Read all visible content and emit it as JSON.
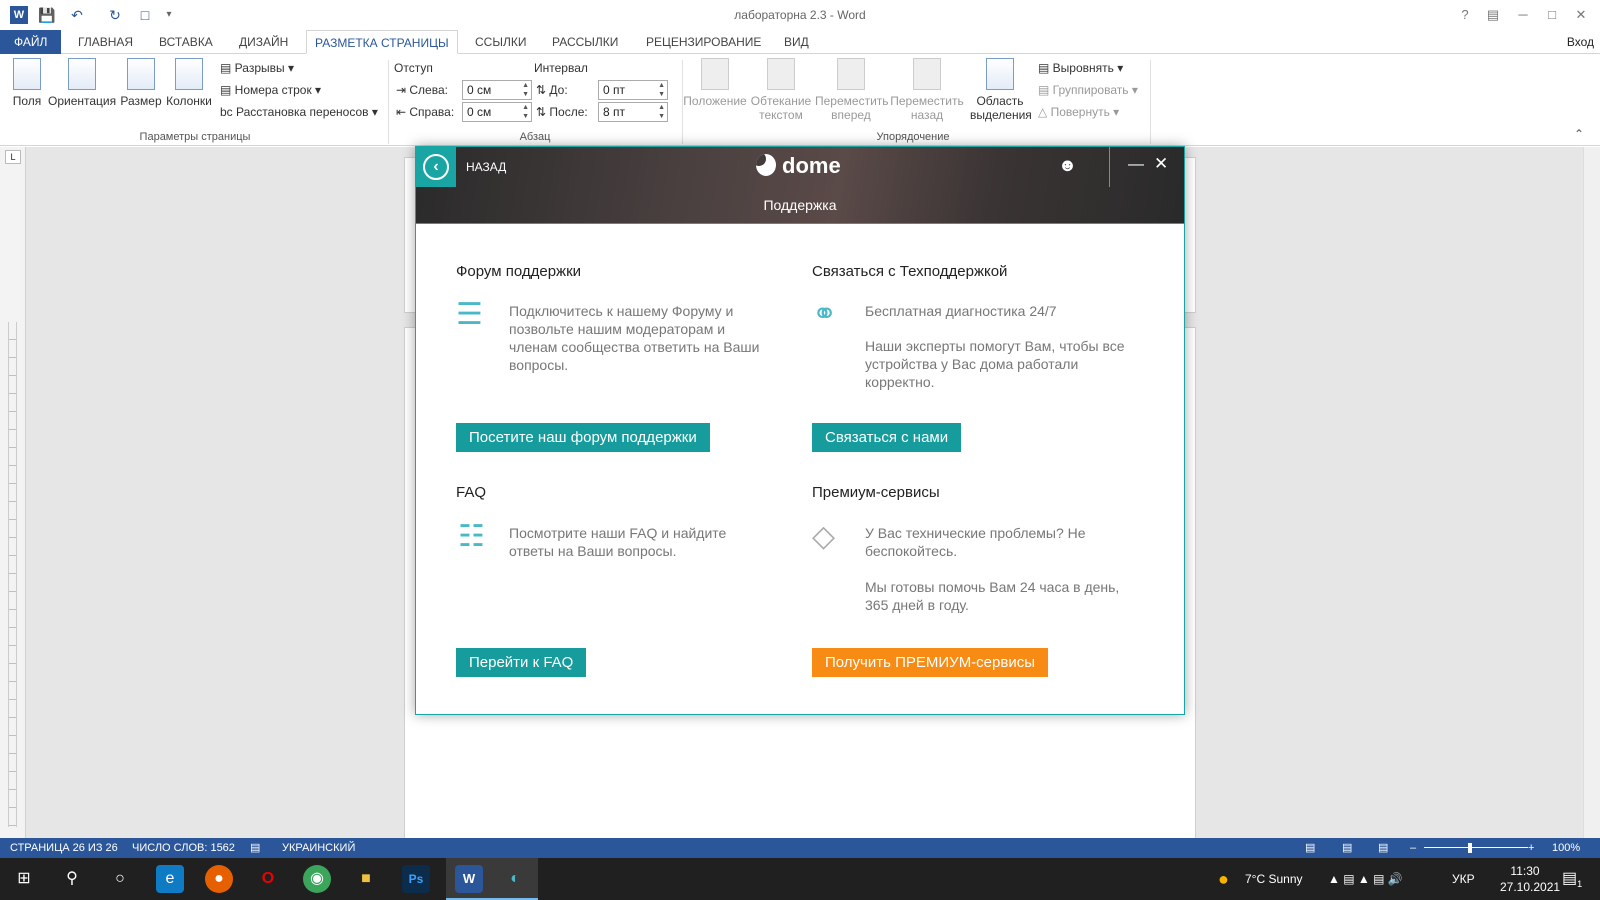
{
  "window": {
    "title": "лабораторна 2.3 - Word",
    "help": "?",
    "minimize": "─",
    "maximize": "□",
    "close": "✕",
    "signin": "Вход"
  },
  "tabs": [
    {
      "label": "ФАЙЛ"
    },
    {
      "label": "ГЛАВНАЯ"
    },
    {
      "label": "ВСТАВКА"
    },
    {
      "label": "ДИЗАЙН"
    },
    {
      "label": "РАЗМЕТКА СТРАНИЦЫ"
    },
    {
      "label": "ССЫЛКИ"
    },
    {
      "label": "РАССЫЛКИ"
    },
    {
      "label": "РЕЦЕНЗИРОВАНИЕ"
    },
    {
      "label": "ВИД"
    }
  ],
  "ribbon": {
    "page_setup": {
      "fields": "Поля",
      "orientation": "Ориентация",
      "size": "Размер",
      "columns": "Колонки",
      "breaks": "Разрывы",
      "line_numbers": "Номера строк",
      "hyphenation": "Расстановка переносов",
      "group_label": "Параметры страницы"
    },
    "paragraph": {
      "indent_label": "Отступ",
      "left_label": "Слева:",
      "left_value": "0 см",
      "right_label": "Справа:",
      "right_value": "0 см",
      "spacing_label": "Интервал",
      "before_label": "До:",
      "before_value": "0 пт",
      "after_label": "После:",
      "after_value": "8 пт",
      "group_label": "Абзац"
    },
    "arrange": {
      "position": "Положение",
      "wrap1": "Обтекание",
      "wrap2": "текстом",
      "forward1": "Переместить",
      "forward2": "вперед",
      "backward1": "Переместить",
      "backward2": "назад",
      "selection1": "Область",
      "selection2": "выделения",
      "align": "Выровнять",
      "group": "Группировать",
      "rotate": "Повернуть",
      "group_label": "Упорядочение"
    }
  },
  "status": {
    "page": "СТРАНИЦА 26 ИЗ 26",
    "words": "ЧИСЛО СЛОВ: 1562",
    "language": "УКРАИНСКИЙ",
    "zoom": "100%"
  },
  "taskbar": {
    "weather": "7°C  Sunny",
    "lang": "УКР",
    "time": "11:30",
    "date": "27.10.2021",
    "notif_count": "1"
  },
  "dome": {
    "back_label": "НАЗАД",
    "logo": "dome",
    "title": "Поддержка",
    "forum": {
      "title": "Форум поддержки",
      "text": "Подключитесь к нашему Форуму и позвольте нашим модераторам и членам сообщества ответить на Ваши вопросы.",
      "button": "Посетите наш форум поддержки"
    },
    "support": {
      "title": "Связаться с Техподдержкой",
      "text1": "Бесплатная диагностика 24/7",
      "text2": "Наши эксперты помогут Вам, чтобы все устройства у Вас дома работали корректно.",
      "button": "Связаться с нами"
    },
    "faq": {
      "title": "FAQ",
      "text": "Посмотрите наши FAQ и найдите ответы на Ваши вопросы.",
      "button": "Перейти к FAQ"
    },
    "premium": {
      "title": "Премиум-сервисы",
      "text1": "У Вас технические проблемы? Не беспокойтесь.",
      "text2": "Мы готовы помочь Вам 24 часа в день, 365 дней в году.",
      "button": "Получить ПРЕМИУМ-сервисы"
    },
    "colors": {
      "teal": "#169c9c",
      "orange": "#f78b14"
    }
  },
  "icons": [
    "word-icon",
    "save-icon",
    "undo-icon",
    "redo-icon",
    "print-preview-icon",
    "customize-icon",
    "chat-icon",
    "headset-icon",
    "list-icon",
    "diamond-icon",
    "user-icon",
    "back-arrow-icon"
  ]
}
